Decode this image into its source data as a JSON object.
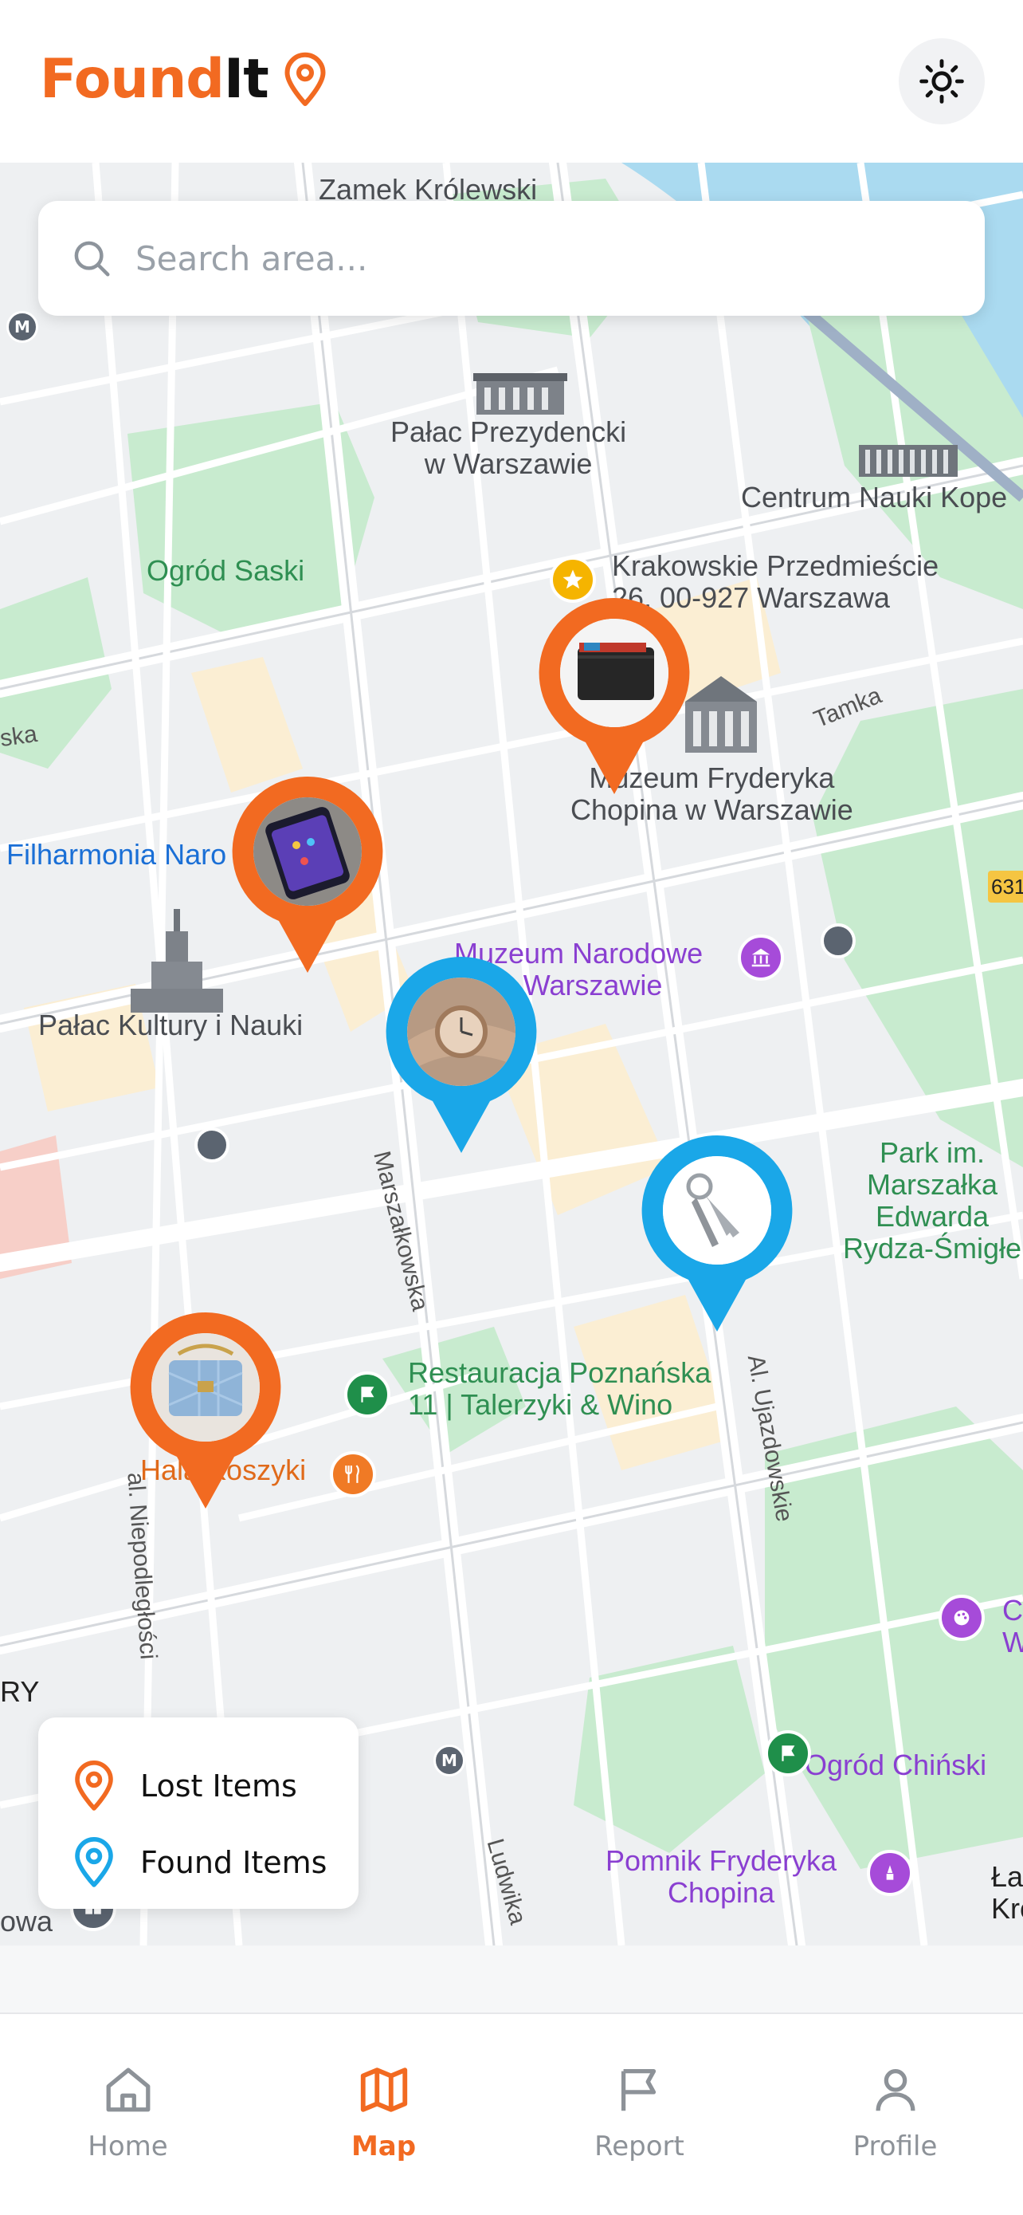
{
  "app": {
    "logo_part1": "Found",
    "logo_part2": "It",
    "logo_icon": "map-pin-icon",
    "theme_toggle_icon": "sun-icon",
    "brand_color": "#f26a21",
    "found_color": "#1aa7e8"
  },
  "search": {
    "placeholder": "Search area...",
    "value": "",
    "icon": "search-icon"
  },
  "map": {
    "labels": {
      "zamek": "Zamek Królewski",
      "palac_prez": "Pałac Prezydencki\nw Warszawie",
      "centrum": "Centrum Nauki Kope",
      "krakowskie": "Krakowskie Przedmieście\n26, 00-927 Warszawa",
      "ogrod_saski": "Ogród Saski",
      "tamka": "Tamka",
      "chopin_museum": "Muzeum Fryderyka\nChopina w Warszawie",
      "filharmonia": "Filharmonia Naro",
      "route_631": "631",
      "muzeum_narodowe": "Muzeum Narodowe\nw Warszawie",
      "palac_kultury": "Pałac Kultury i Nauki",
      "park": "Park im.\nMarszałka\nEdwarda\nRydza-Śmigłe",
      "marszalkowska": "Marszałkowska",
      "restauracja": "Restauracja Poznańska\n11 | Talerzyki & Wino",
      "hala_koszyki": "Hala Koszyki",
      "ujazdowskie": "Al. Ujazdowskie",
      "niepodleglosci": "al. Niepodległości",
      "ry": "RY",
      "ogrod_chinski": "Ogród Chiński",
      "pomnik": "Pomnik Fryderyka\nChopina",
      "ludwika": "Ludwika",
      "owa": "owa",
      "ska": "ska",
      "lazienki": "Łaz\nKról",
      "c_w": "C\nW"
    },
    "metro_letter": "M",
    "markers": [
      {
        "type": "lost",
        "item": "wallet"
      },
      {
        "type": "lost",
        "item": "phone"
      },
      {
        "type": "found",
        "item": "watch"
      },
      {
        "type": "found",
        "item": "keys"
      },
      {
        "type": "lost",
        "item": "handbag"
      }
    ]
  },
  "legend": {
    "lost_label": "Lost Items",
    "found_label": "Found Items",
    "lost_color": "#f26a21",
    "found_color": "#1aa7e8"
  },
  "nav": {
    "items": [
      {
        "label": "Home",
        "icon": "home-icon",
        "active": false
      },
      {
        "label": "Map",
        "icon": "map-icon",
        "active": true
      },
      {
        "label": "Report",
        "icon": "flag-icon",
        "active": false
      },
      {
        "label": "Profile",
        "icon": "user-icon",
        "active": false
      }
    ]
  }
}
